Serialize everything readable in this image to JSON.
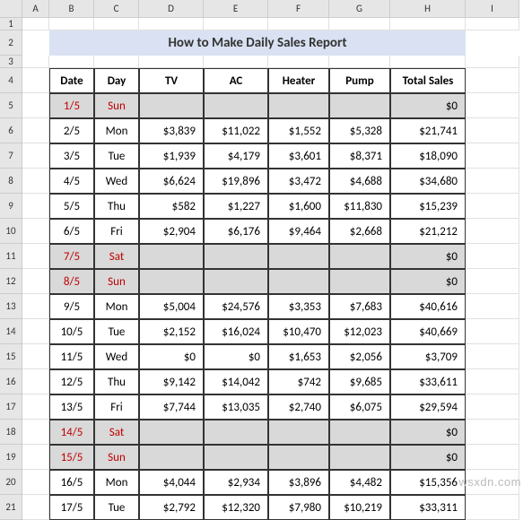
{
  "columns": [
    "A",
    "B",
    "C",
    "D",
    "E",
    "F",
    "G",
    "H",
    "I"
  ],
  "col_widths": [
    "wA",
    "wB",
    "wC",
    "wD",
    "wE",
    "wF",
    "wG",
    "wH",
    "wI"
  ],
  "row_numbers": [
    "1",
    "2",
    "3",
    "4",
    "5",
    "6",
    "7",
    "8",
    "9",
    "10",
    "11",
    "12",
    "13",
    "14",
    "15",
    "16",
    "17",
    "18",
    "19",
    "20",
    "21"
  ],
  "title": "How to Make Daily Sales Report",
  "headers": {
    "date": "Date",
    "day": "Day",
    "tv": "TV",
    "ac": "AC",
    "heater": "Heater",
    "pump": "Pump",
    "total": "Total Sales"
  },
  "rows": [
    {
      "date": "1/5",
      "day": "Sun",
      "tv": "",
      "ac": "",
      "heater": "",
      "pump": "",
      "total": "$0",
      "weekend": true
    },
    {
      "date": "2/5",
      "day": "Mon",
      "tv": "$3,839",
      "ac": "$11,022",
      "heater": "$1,552",
      "pump": "$5,328",
      "total": "$21,741",
      "weekend": false
    },
    {
      "date": "3/5",
      "day": "Tue",
      "tv": "$1,939",
      "ac": "$4,179",
      "heater": "$3,601",
      "pump": "$8,371",
      "total": "$18,090",
      "weekend": false
    },
    {
      "date": "4/5",
      "day": "Wed",
      "tv": "$6,624",
      "ac": "$19,896",
      "heater": "$3,472",
      "pump": "$4,688",
      "total": "$34,680",
      "weekend": false
    },
    {
      "date": "5/5",
      "day": "Thu",
      "tv": "$582",
      "ac": "$1,227",
      "heater": "$1,600",
      "pump": "$11,830",
      "total": "$15,239",
      "weekend": false
    },
    {
      "date": "6/5",
      "day": "Fri",
      "tv": "$2,904",
      "ac": "$6,176",
      "heater": "$9,464",
      "pump": "$2,668",
      "total": "$21,212",
      "weekend": false
    },
    {
      "date": "7/5",
      "day": "Sat",
      "tv": "",
      "ac": "",
      "heater": "",
      "pump": "",
      "total": "$0",
      "weekend": true
    },
    {
      "date": "8/5",
      "day": "Sun",
      "tv": "",
      "ac": "",
      "heater": "",
      "pump": "",
      "total": "$0",
      "weekend": true
    },
    {
      "date": "9/5",
      "day": "Mon",
      "tv": "$5,004",
      "ac": "$24,576",
      "heater": "$3,353",
      "pump": "$7,683",
      "total": "$40,616",
      "weekend": false
    },
    {
      "date": "10/5",
      "day": "Tue",
      "tv": "$2,152",
      "ac": "$16,024",
      "heater": "$10,470",
      "pump": "$12,023",
      "total": "$40,669",
      "weekend": false
    },
    {
      "date": "11/5",
      "day": "Wed",
      "tv": "$0",
      "ac": "$0",
      "heater": "$1,653",
      "pump": "$2,056",
      "total": "$3,709",
      "weekend": false
    },
    {
      "date": "12/5",
      "day": "Thu",
      "tv": "$9,142",
      "ac": "$14,042",
      "heater": "$742",
      "pump": "$9,685",
      "total": "$33,611",
      "weekend": false
    },
    {
      "date": "13/5",
      "day": "Fri",
      "tv": "$7,744",
      "ac": "$13,035",
      "heater": "$2,740",
      "pump": "$6,075",
      "total": "$29,594",
      "weekend": false
    },
    {
      "date": "14/5",
      "day": "Sat",
      "tv": "",
      "ac": "",
      "heater": "",
      "pump": "",
      "total": "$0",
      "weekend": true
    },
    {
      "date": "15/5",
      "day": "Sun",
      "tv": "",
      "ac": "",
      "heater": "",
      "pump": "",
      "total": "$0",
      "weekend": true
    },
    {
      "date": "16/5",
      "day": "Mon",
      "tv": "$4,044",
      "ac": "$2,934",
      "heater": "$3,896",
      "pump": "$4,482",
      "total": "$15,356",
      "weekend": false
    },
    {
      "date": "17/5",
      "day": "Tue",
      "tv": "$2,792",
      "ac": "$12,320",
      "heater": "$7,980",
      "pump": "$10,219",
      "total": "$33,311",
      "weekend": false
    }
  ],
  "watermark": "wsxdn.com",
  "chart_data": {
    "type": "table",
    "title": "How to Make Daily Sales Report",
    "columns": [
      "Date",
      "Day",
      "TV",
      "AC",
      "Heater",
      "Pump",
      "Total Sales"
    ],
    "data": [
      [
        "1/5",
        "Sun",
        null,
        null,
        null,
        null,
        0
      ],
      [
        "2/5",
        "Mon",
        3839,
        11022,
        1552,
        5328,
        21741
      ],
      [
        "3/5",
        "Tue",
        1939,
        4179,
        3601,
        8371,
        18090
      ],
      [
        "4/5",
        "Wed",
        6624,
        19896,
        3472,
        4688,
        34680
      ],
      [
        "5/5",
        "Thu",
        582,
        1227,
        1600,
        11830,
        15239
      ],
      [
        "6/5",
        "Fri",
        2904,
        6176,
        9464,
        2668,
        21212
      ],
      [
        "7/5",
        "Sat",
        null,
        null,
        null,
        null,
        0
      ],
      [
        "8/5",
        "Sun",
        null,
        null,
        null,
        null,
        0
      ],
      [
        "9/5",
        "Mon",
        5004,
        24576,
        3353,
        7683,
        40616
      ],
      [
        "10/5",
        "Tue",
        2152,
        16024,
        10470,
        12023,
        40669
      ],
      [
        "11/5",
        "Wed",
        0,
        0,
        1653,
        2056,
        3709
      ],
      [
        "12/5",
        "Thu",
        9142,
        14042,
        742,
        9685,
        33611
      ],
      [
        "13/5",
        "Fri",
        7744,
        13035,
        2740,
        6075,
        29594
      ],
      [
        "14/5",
        "Sat",
        null,
        null,
        null,
        null,
        0
      ],
      [
        "15/5",
        "Sun",
        null,
        null,
        null,
        null,
        0
      ],
      [
        "16/5",
        "Mon",
        4044,
        2934,
        3896,
        4482,
        15356
      ],
      [
        "17/5",
        "Tue",
        2792,
        12320,
        7980,
        10219,
        33311
      ]
    ]
  }
}
